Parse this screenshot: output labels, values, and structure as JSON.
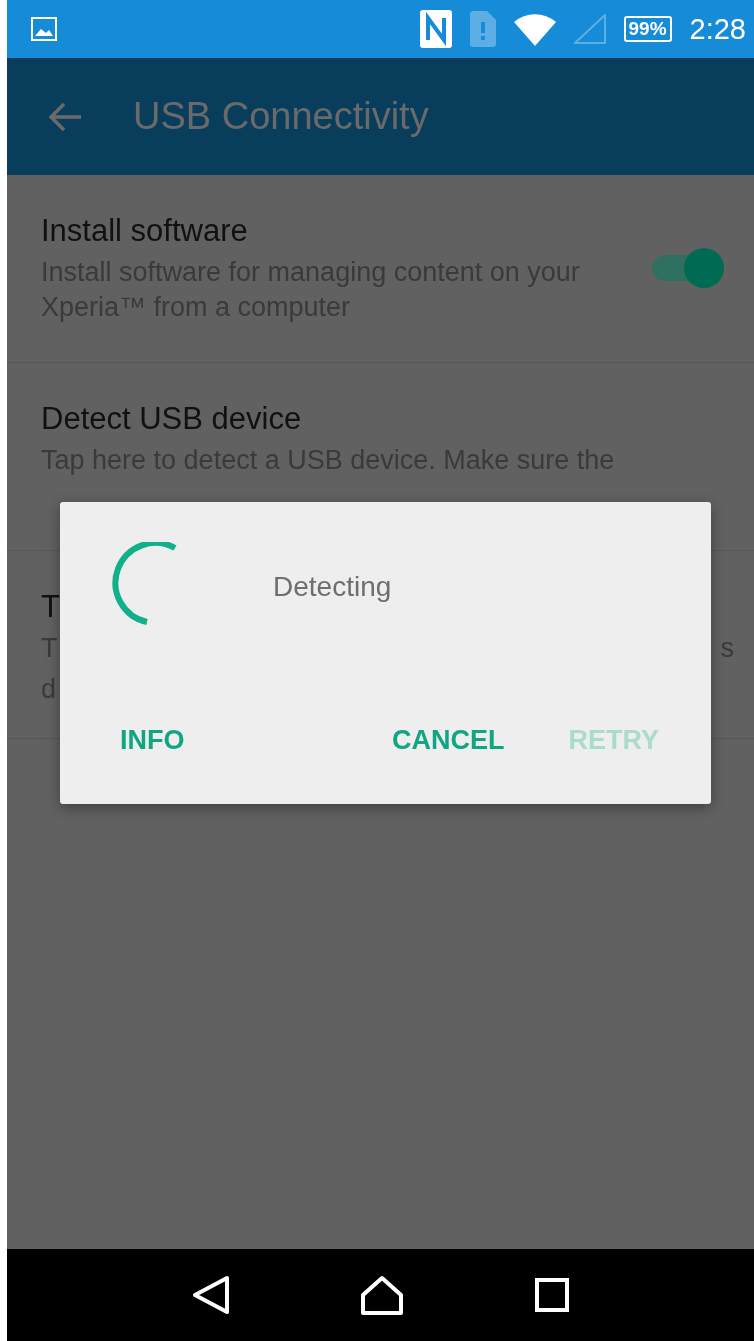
{
  "status_bar": {
    "time": "2:28",
    "battery": "99%"
  },
  "app_bar": {
    "title": "USB Connectivity"
  },
  "settings": [
    {
      "kind": "toggle",
      "title": "Install software",
      "description": "Install software for managing content on your Xperia™ from a computer",
      "on": true
    },
    {
      "kind": "plain",
      "title": "Detect USB device",
      "description": "Tap here to detect a USB device. Make sure the"
    },
    {
      "kind": "covered",
      "title": "T",
      "line_1_start": "T",
      "line_1_end": "s",
      "line_2_start": "d"
    }
  ],
  "dialog": {
    "message": "Detecting",
    "buttons": [
      {
        "label": "INFO",
        "disabled": false
      },
      {
        "label": "CANCEL",
        "disabled": false
      },
      {
        "label": "RETRY",
        "disabled": true
      }
    ]
  }
}
